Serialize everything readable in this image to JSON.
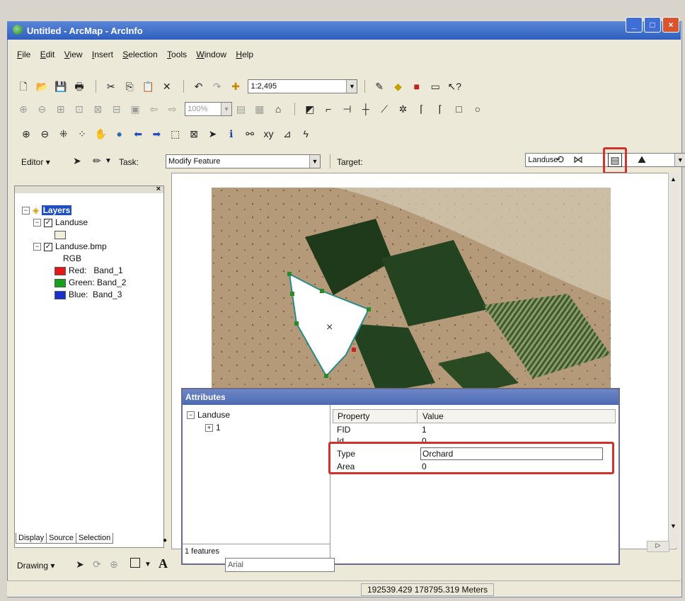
{
  "window": {
    "title": "Untitled - ArcMap - ArcInfo"
  },
  "menu": [
    "File",
    "Edit",
    "View",
    "Insert",
    "Selection",
    "Tools",
    "Window",
    "Help"
  ],
  "toolbar": {
    "scale": "1:2,495",
    "zoom_percent": "100%"
  },
  "editor": {
    "editor_label": "Editor",
    "task_label": "Task:",
    "task_value": "Modify Feature",
    "target_label": "Target:",
    "target_value": "Landuse"
  },
  "toc": {
    "root": "Layers",
    "layer1": "Landuse",
    "layer2": "Landuse.bmp",
    "rgb": "RGB",
    "red": "Red:   Band_1",
    "green": "Green: Band_2",
    "blue": "Blue:  Band_3",
    "tabs": [
      "Display",
      "Source",
      "Selection"
    ]
  },
  "attributes": {
    "title": "Attributes",
    "tree_root": "Landuse",
    "tree_child": "1",
    "status": "1 features",
    "col_property": "Property",
    "col_value": "Value",
    "rows": [
      {
        "property": "FID",
        "value": "1"
      },
      {
        "property": "Id",
        "value": "0"
      },
      {
        "property": "Type",
        "value": "Orchard"
      },
      {
        "property": "Area",
        "value": "0"
      }
    ]
  },
  "drawing": {
    "label": "Drawing",
    "font": "Arial"
  },
  "status": {
    "coords": "192539.429  178795.319 Meters"
  },
  "colors": {
    "highlight_red": "#d1322b",
    "swatch_red": "#e01818",
    "swatch_green": "#18a018",
    "swatch_blue": "#1830c8"
  }
}
